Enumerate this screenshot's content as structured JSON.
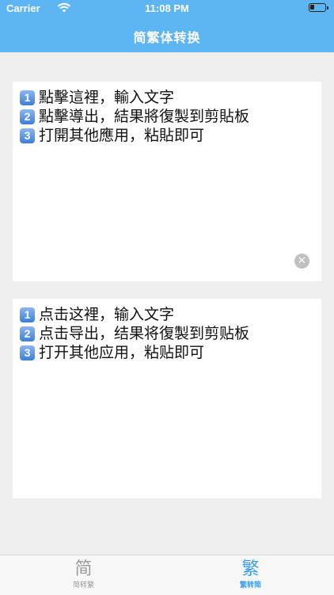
{
  "status_bar": {
    "carrier": "Carrier",
    "time": "11:08 PM"
  },
  "header": {
    "title": "简繁体转换"
  },
  "traditional_box": {
    "lines": [
      {
        "badge": "1",
        "text": "點擊這裡，輸入文字"
      },
      {
        "badge": "2",
        "text": "點擊導出，結果將復製到剪貼板"
      },
      {
        "badge": "3",
        "text": "打開其他應用，粘貼即可"
      }
    ],
    "clear_icon": "close-circle-icon"
  },
  "simplified_box": {
    "lines": [
      {
        "badge": "1",
        "text": "点击这裡，输入文字"
      },
      {
        "badge": "2",
        "text": "点击导出，结果将復製到剪贴板"
      },
      {
        "badge": "3",
        "text": "打开其他应用，粘贴即可"
      }
    ]
  },
  "tabs": [
    {
      "icon_glyph": "简",
      "label": "简转繁",
      "active": false
    },
    {
      "icon_glyph": "繁",
      "label": "繁转简",
      "active": true
    }
  ],
  "colors": {
    "header_bg": "#5eb5f3",
    "tab_active": "#3b9cf0",
    "tab_inactive": "#9a9a9a",
    "page_bg": "#efefef"
  }
}
